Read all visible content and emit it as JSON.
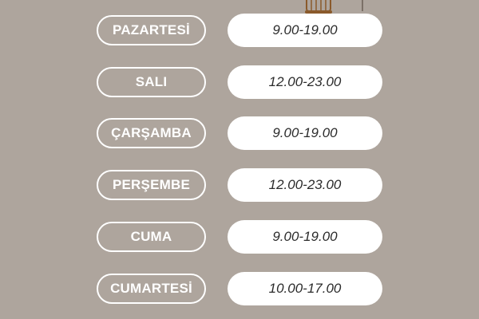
{
  "schedule": [
    {
      "day": "PAZARTESİ",
      "hours": "9.00-19.00"
    },
    {
      "day": "SALI",
      "hours": "12.00-23.00"
    },
    {
      "day": "ÇARŞAMBA",
      "hours": "9.00-19.00"
    },
    {
      "day": "PERŞEMBE",
      "hours": "12.00-23.00"
    },
    {
      "day": "CUMA",
      "hours": "9.00-19.00"
    },
    {
      "day": "CUMARTESİ",
      "hours": "10.00-17.00"
    }
  ],
  "colors": {
    "background": "#aea59d",
    "pill_outline": "#ffffff",
    "hours_background": "#ffffff",
    "hours_text": "#2b2b2b",
    "lantern": "#8a5a2b"
  },
  "icons": {
    "decoration": "hanging-lantern-icon"
  }
}
